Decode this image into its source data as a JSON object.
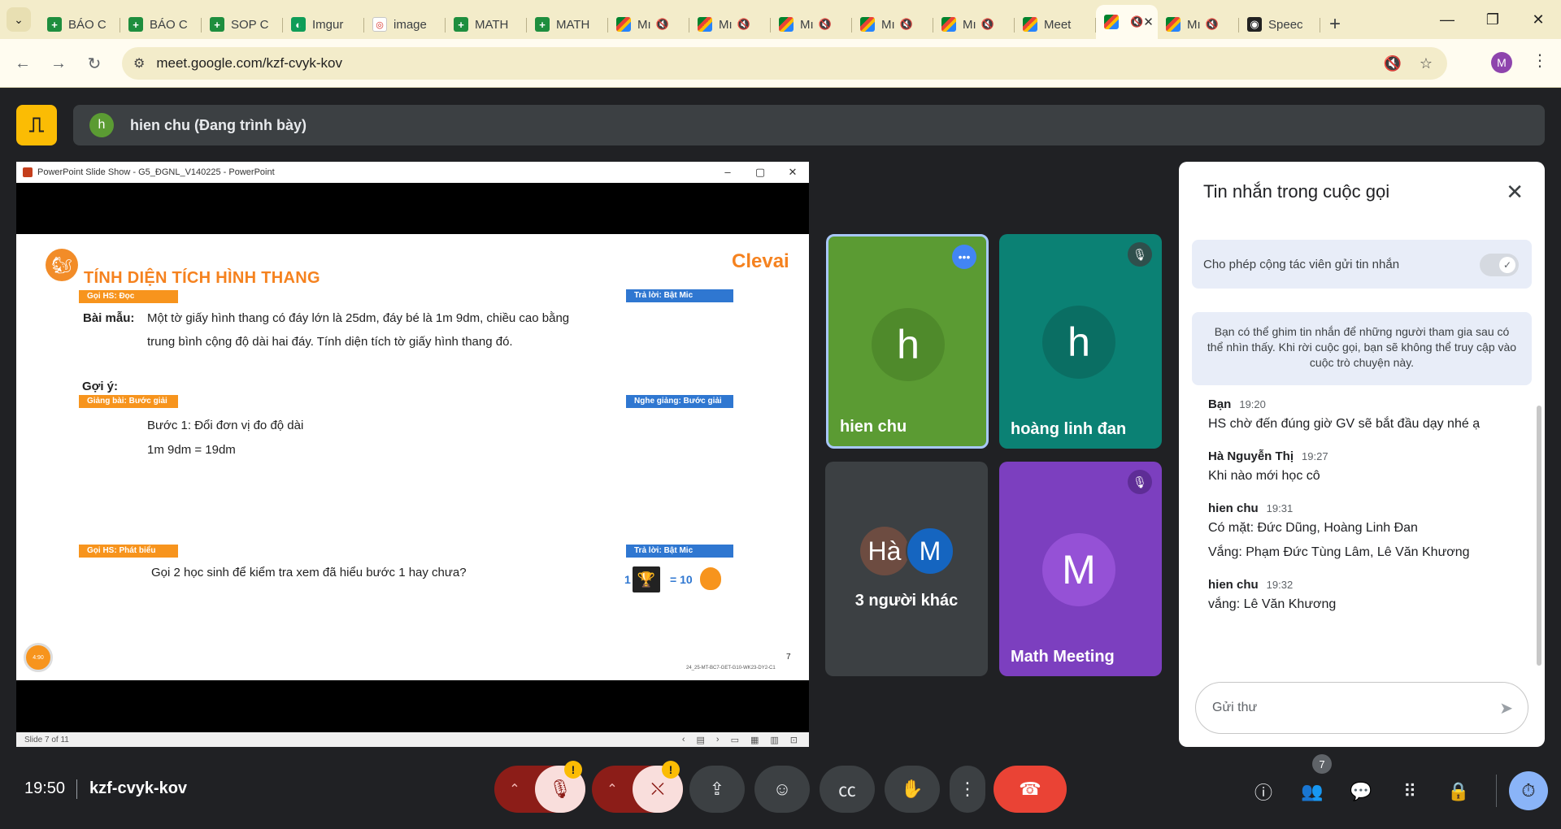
{
  "browser": {
    "tabs": [
      {
        "label": "BÁO C",
        "icon": "sheets-icon",
        "muted": false
      },
      {
        "label": "BÁO C",
        "icon": "sheets-icon",
        "muted": false
      },
      {
        "label": "SOP C",
        "icon": "sheets-icon",
        "muted": false
      },
      {
        "label": "Imgur",
        "icon": "imgur-icon",
        "muted": false
      },
      {
        "label": "image",
        "icon": "image-icon",
        "muted": false
      },
      {
        "label": "MATH",
        "icon": "sheets-icon",
        "muted": false
      },
      {
        "label": "MATH",
        "icon": "sheets-icon",
        "muted": false
      },
      {
        "label": "Mı",
        "icon": "meet-icon",
        "muted": true
      },
      {
        "label": "Mı",
        "icon": "meet-icon",
        "muted": true
      },
      {
        "label": "Mı",
        "icon": "meet-icon",
        "muted": true
      },
      {
        "label": "Mı",
        "icon": "meet-icon",
        "muted": true
      },
      {
        "label": "Mı",
        "icon": "meet-icon",
        "muted": true
      },
      {
        "label": "Meet",
        "icon": "meet-icon",
        "muted": false
      },
      {
        "label": "",
        "icon": "meet-icon",
        "muted": true,
        "active": true
      },
      {
        "label": "Mı",
        "icon": "meet-icon",
        "muted": true
      },
      {
        "label": "Speec",
        "icon": "speed-icon",
        "muted": false
      }
    ],
    "url": "meet.google.com/kzf-cvyk-kov",
    "profile_initial": "M"
  },
  "meet": {
    "presenter_initial": "h",
    "presenter_banner": "hien chu (Đang trình bày)",
    "ppt": {
      "window_title": "PowerPoint Slide Show  -  G5_ĐGNL_V140225 - PowerPoint",
      "status_left": "Slide 7 of 11",
      "slide": {
        "title": "TÍNH DIỆN TÍCH HÌNH THANG",
        "brand": "Clevai",
        "tag_read": "Gọi HS: Đọc",
        "tag_answer1": "Trả lời: Bật Mic",
        "sample_label": "Bài mẫu:",
        "sample_line1": "Một tờ giấy hình thang có đáy lớn là 25dm, đáy bé là 1m 9dm, chiều cao bằng",
        "sample_line2": "trung bình cộng độ dài hai đáy. Tính diện tích tờ giấy hình thang đó.",
        "hint_label": "Gợi ý:",
        "tag_teach": "Giảng bài: Bước giải",
        "tag_listen": "Nghe giảng: Bước giải",
        "step1": "Bước 1: Đổi đơn vị đo độ dài",
        "step1_calc": "1m 9dm = 19dm",
        "tag_speak": "Gọi HS: Phát biểu",
        "tag_answer2": "Trả lời: Bật Mic",
        "ask": "Gọi 2 học sinh để kiểm tra xem đã hiểu bước 1 hay chưa?",
        "reward_count": "1",
        "reward_eq": "= 10",
        "page_number": "7",
        "footer_code": "24_25-MT-BC7-GET-G10-WK23-DY2-C1",
        "timer": "4:90"
      }
    },
    "tiles": [
      {
        "name": "hien chu",
        "initial": "h",
        "color": "#5b9b33"
      },
      {
        "name": "hoàng linh đan",
        "initial": "h",
        "color": "#0b8174"
      },
      {
        "name": "3 người khác",
        "initial_a": "Hà",
        "initial_b": "M"
      },
      {
        "name": "Math Meeting",
        "initial": "M",
        "color": "#7c3fbf"
      }
    ],
    "chat": {
      "title": "Tin nhắn trong cuộc gọi",
      "toggle_label": "Cho phép cộng tác viên gửi tin nhắn",
      "toggle_on": true,
      "pin_note": "Bạn có thể ghim tin nhắn để những người tham gia sau có thể nhìn thấy. Khi rời cuộc gọi, bạn sẽ không thể truy cập vào cuộc trò chuyện này.",
      "messages": [
        {
          "sender": "Bạn",
          "time": "19:20",
          "lines": [
            "HS chờ đến đúng giờ GV sẽ bắt đầu dạy nhé ạ"
          ]
        },
        {
          "sender": "Hà Nguyễn Thị",
          "time": "19:27",
          "lines": [
            "Khi nào mới học cô"
          ]
        },
        {
          "sender": "hien chu",
          "time": "19:31",
          "lines": [
            "Có mặt: Đức Dũng, Hoàng Linh Đan",
            "Vắng: Phạm Đức Tùng Lâm, Lê Văn Khương"
          ]
        },
        {
          "sender": "hien chu",
          "time": "19:32",
          "lines": [
            "vắng: Lê Văn Khương"
          ]
        }
      ],
      "input_placeholder": "Gửi thư"
    },
    "bottom": {
      "time": "19:50",
      "meeting_code": "kzf-cvyk-kov",
      "people_count": "7",
      "warning": "!"
    }
  }
}
